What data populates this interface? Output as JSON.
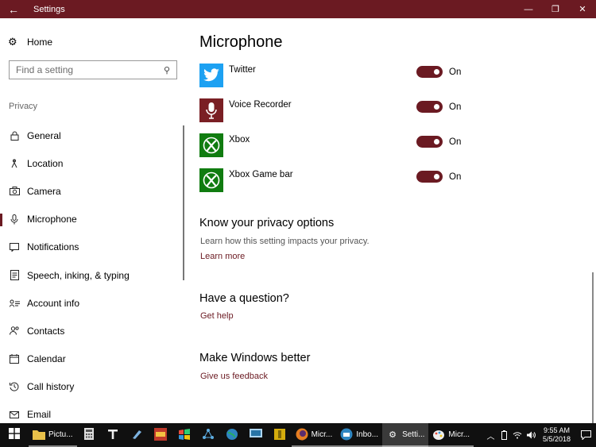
{
  "window": {
    "title": "Settings",
    "back_glyph": "←",
    "minimize_glyph": "—",
    "restore_glyph": "❐",
    "close_glyph": "✕"
  },
  "sidebar": {
    "home_label": "Home",
    "search_placeholder": "Find a setting",
    "section_label": "Privacy",
    "items": [
      {
        "label": "General",
        "icon": "lock-icon"
      },
      {
        "label": "Location",
        "icon": "location-icon"
      },
      {
        "label": "Camera",
        "icon": "camera-icon"
      },
      {
        "label": "Microphone",
        "icon": "microphone-icon",
        "active": true
      },
      {
        "label": "Notifications",
        "icon": "notifications-icon"
      },
      {
        "label": "Speech, inking, & typing",
        "icon": "speech-icon"
      },
      {
        "label": "Account info",
        "icon": "account-info-icon"
      },
      {
        "label": "Contacts",
        "icon": "contacts-icon"
      },
      {
        "label": "Calendar",
        "icon": "calendar-icon"
      },
      {
        "label": "Call history",
        "icon": "call-history-icon"
      },
      {
        "label": "Email",
        "icon": "email-icon"
      }
    ]
  },
  "main": {
    "title": "Microphone",
    "apps": [
      {
        "name": "Twitter",
        "state": "On",
        "icon": "twitter-icon",
        "color": "#1da1f2"
      },
      {
        "name": "Voice Recorder",
        "state": "On",
        "icon": "voice-recorder-icon",
        "color": "#7a1f24"
      },
      {
        "name": "Xbox",
        "state": "On",
        "icon": "xbox-icon",
        "color": "#107c10"
      },
      {
        "name": "Xbox Game bar",
        "state": "On",
        "icon": "xbox-icon",
        "color": "#107c10"
      }
    ],
    "privacy": {
      "heading": "Know your privacy options",
      "description": "Learn how this setting impacts your privacy.",
      "link": "Learn more"
    },
    "question": {
      "heading": "Have a question?",
      "link": "Get help"
    },
    "better": {
      "heading": "Make Windows better",
      "link": "Give us feedback"
    }
  },
  "taskbar": {
    "apps": [
      {
        "label": "Pictu...",
        "icon": "folder-icon"
      },
      {
        "label": "Micr...",
        "icon": "firefox-icon"
      },
      {
        "label": "Inbo...",
        "icon": "thunderbird-icon"
      },
      {
        "label": "Setti...",
        "icon": "gear-icon"
      },
      {
        "label": "Micr...",
        "icon": "paint-icon"
      }
    ],
    "time": "9:55 AM",
    "date": "5/5/2018"
  },
  "colors": {
    "accent": "#6b1a22",
    "taskbar": "#101010"
  }
}
